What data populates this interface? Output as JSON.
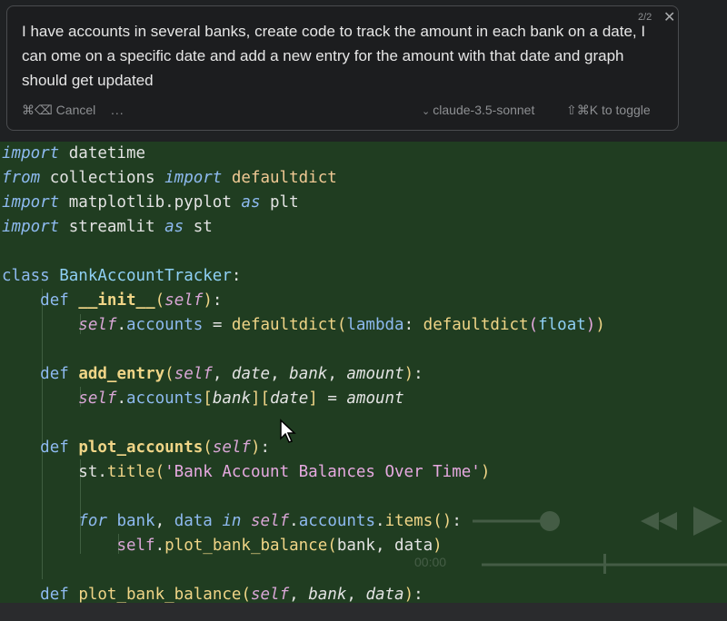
{
  "prompt": {
    "counter": "2/2",
    "text": "I have accounts in several banks, create code to track the amount in each bank on a date, I can ome on a specific date and add a new entry for the amount with that date and graph should get updated",
    "cancel_label": "⌘⌫ Cancel",
    "more_label": "...",
    "model_label": "claude-3.5-sonnet",
    "toggle_label": "⇧⌘K to toggle"
  },
  "media": {
    "time_label": "00:00"
  },
  "code": {
    "lines": [
      "import datetime",
      "from collections import defaultdict",
      "import matplotlib.pyplot as plt",
      "import streamlit as st",
      "",
      "class BankAccountTracker:",
      "    def __init__(self):",
      "        self.accounts = defaultdict(lambda: defaultdict(float))",
      "",
      "    def add_entry(self, date, bank, amount):",
      "        self.accounts[bank][date] = amount",
      "",
      "    def plot_accounts(self):",
      "        st.title('Bank Account Balances Over Time')",
      "",
      "        for bank, data in self.accounts.items():",
      "            self.plot_bank_balance(bank, data)",
      "",
      "    def plot_bank_balance(self, bank, data):"
    ]
  }
}
